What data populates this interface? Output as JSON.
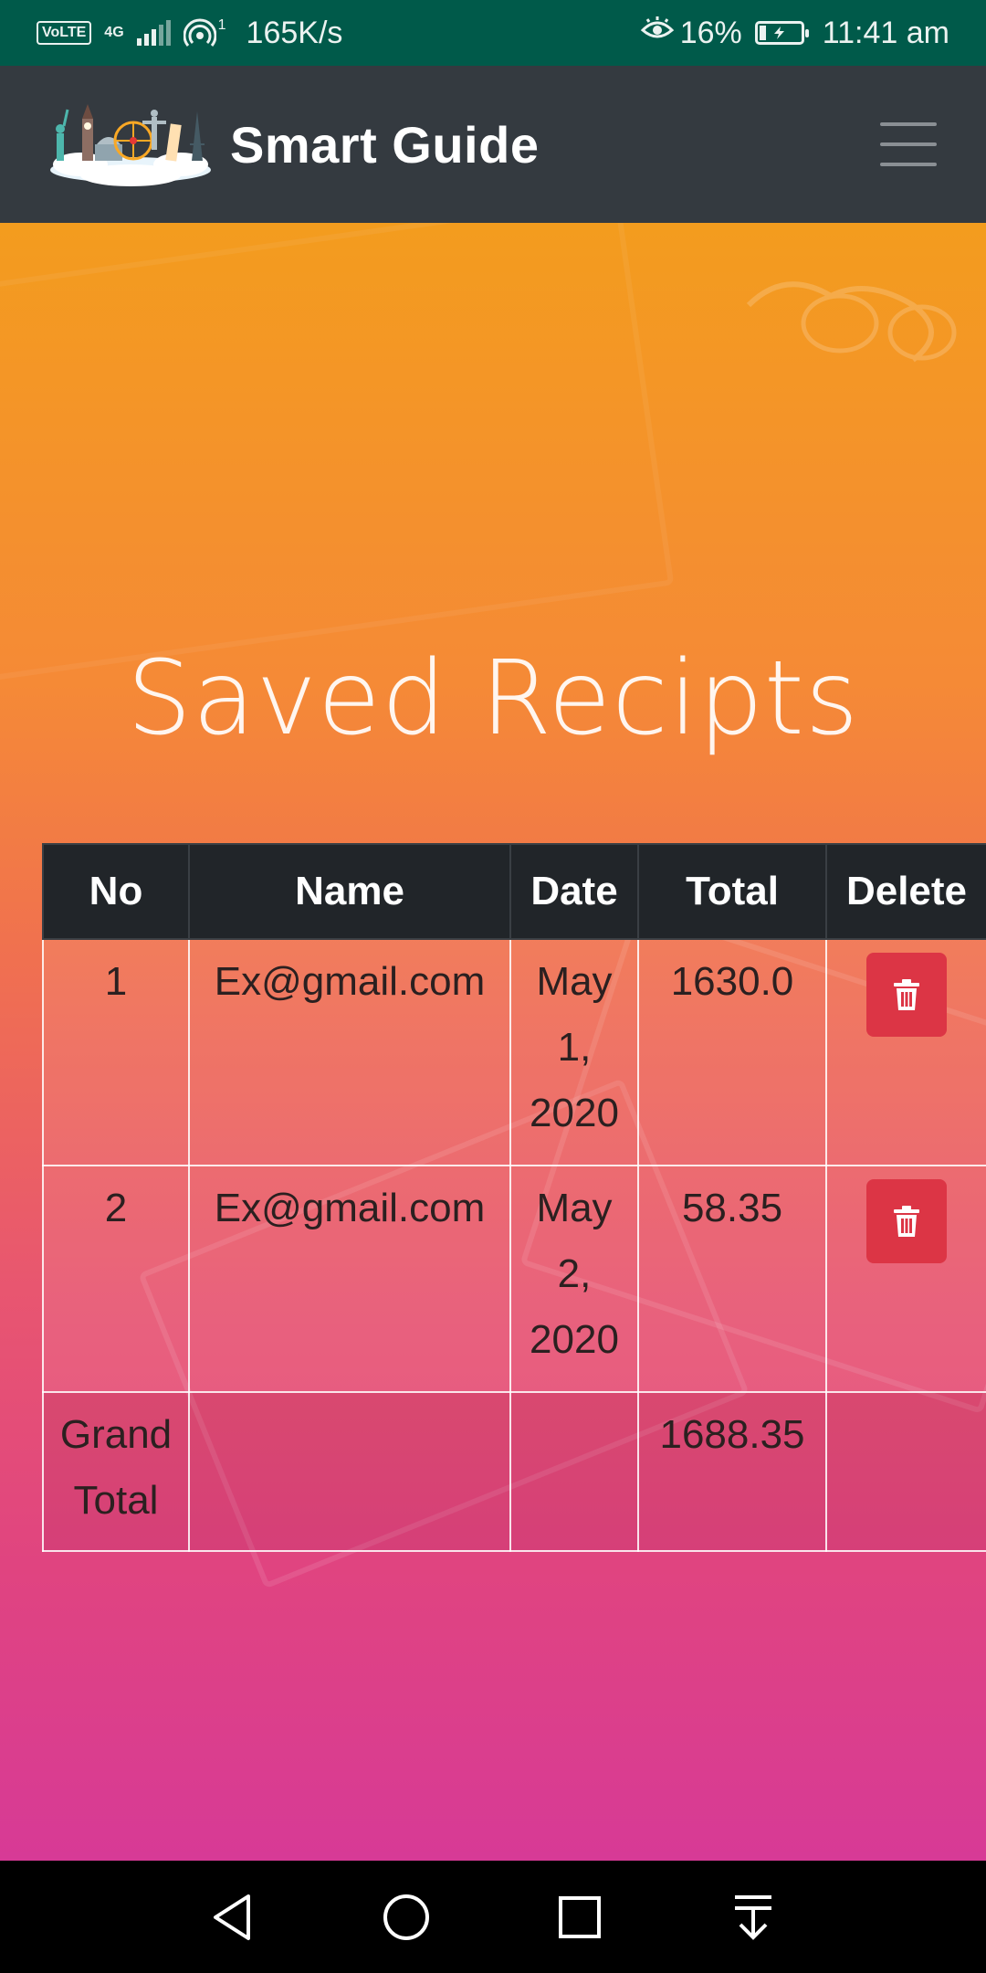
{
  "status_bar": {
    "volte": "VoLTE",
    "network": "4G",
    "hotspot_badge": "1",
    "speed": "165K/s",
    "battery": "16%",
    "time": "11:41 am",
    "battery_level": 0.16
  },
  "navbar": {
    "brand": "Smart Guide",
    "logo": "travel-landmarks-logo",
    "menu_icon": "hamburger-menu-icon"
  },
  "page": {
    "title": "Saved Recipts"
  },
  "table": {
    "headers": [
      "No",
      "Name",
      "Date",
      "Total",
      "Delete"
    ],
    "rows": [
      {
        "no": "1",
        "name": "Ex@gmail.com",
        "date_month": "May",
        "date_day": "1,",
        "date_year": "2020",
        "total": "1630.0"
      },
      {
        "no": "2",
        "name": "Ex@gmail.com",
        "date_month": "May",
        "date_day": "2,",
        "date_year": "2020",
        "total": "58.35"
      }
    ],
    "grand_total_label_1": "Grand",
    "grand_total_label_2": "Total",
    "grand_total_value": "1688.35",
    "delete_icon": "trash-icon"
  },
  "colors": {
    "status_bar": "#005a4a",
    "navbar": "#343a40",
    "table_header": "#212529",
    "delete_button": "#dc3545",
    "gradient_top": "#f39c1e",
    "gradient_bottom": "#d73a96"
  },
  "bottom_nav": {
    "icons": [
      "back-icon",
      "home-icon",
      "recents-icon",
      "notification-pull-icon"
    ]
  }
}
